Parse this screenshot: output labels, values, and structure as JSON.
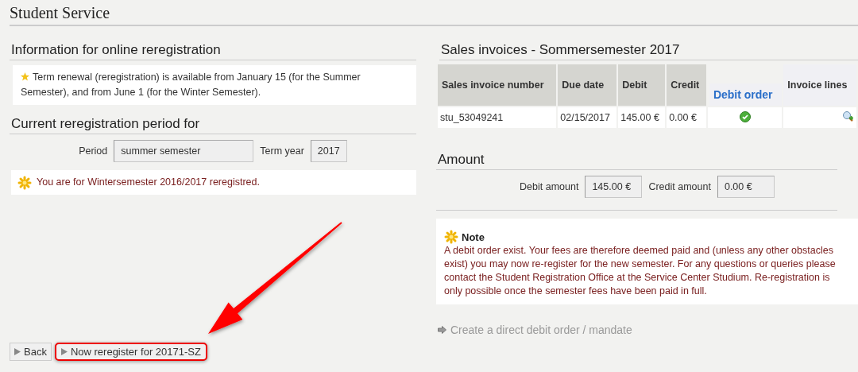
{
  "page_title": "Student Service",
  "info": {
    "heading": "Information for online reregistration",
    "text": "Term renewal (reregistration) is available from January 15 (for the Summer Semester), and from June 1 (for the Winter Semester)."
  },
  "period": {
    "heading": "Current reregistration period for",
    "fields": [
      {
        "label": "Period",
        "value": "summer semester"
      },
      {
        "label": "Term year",
        "value": "2017"
      }
    ],
    "message": "You are for Wintersemester 2016/2017 reregistred."
  },
  "buttons": [
    {
      "label": "Back",
      "highlighted": false
    },
    {
      "label": "Now reregister for 20171-SZ",
      "highlighted": true
    }
  ],
  "invoices": {
    "heading": "Sales invoices - Sommersemester 2017",
    "columns": [
      {
        "label": "Sales invoice number",
        "kind": "plain"
      },
      {
        "label": "Due date",
        "kind": "plain"
      },
      {
        "label": "Debit",
        "kind": "plain"
      },
      {
        "label": "Credit",
        "kind": "plain"
      },
      {
        "label": "Debit order",
        "kind": "link"
      },
      {
        "label": "Invoice lines",
        "kind": "action"
      }
    ],
    "rows": [
      {
        "cells": [
          "stu_53049241",
          "02/15/2017",
          "145.00 €",
          "0.00 €"
        ]
      }
    ]
  },
  "amount": {
    "heading": "Amount",
    "fields": [
      {
        "label": "Debit amount",
        "value": "145.00 €"
      },
      {
        "label": "Credit amount",
        "value": "0.00 €"
      }
    ]
  },
  "note": {
    "title": "Note",
    "text": "A debit order exist. Your fees are therefore deemed paid and (unless any other obstacles exist) you may now re-register for the new semester. For any questions or queries please contact the Student Registration Office at the Service Center Studium. Re-registration is only possible once the semester fees have been paid in full."
  },
  "mandate_link": {
    "label": "Create a direct debit order / mandate",
    "disabled": true
  }
}
